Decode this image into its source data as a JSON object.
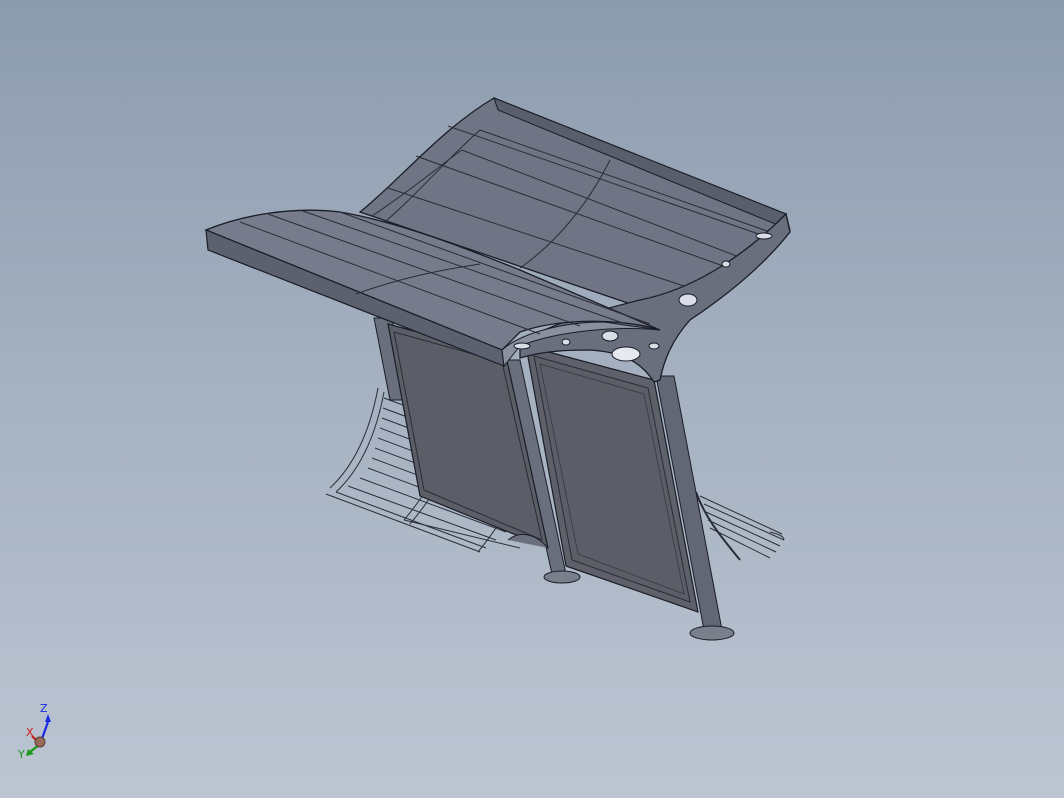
{
  "viewport": {
    "background_top": "#8c9bae",
    "background_bottom": "#bcc5d2",
    "model_fill": "#6f7585",
    "model_edge": "#1a1d26",
    "glass_fill": "#5b5e66"
  },
  "triad": {
    "z_label": "Z",
    "x_label": "X",
    "y_label": "Y",
    "z_color": "#1a2ae0",
    "x_color": "#d01a1a",
    "y_color": "#1a9a1a"
  }
}
